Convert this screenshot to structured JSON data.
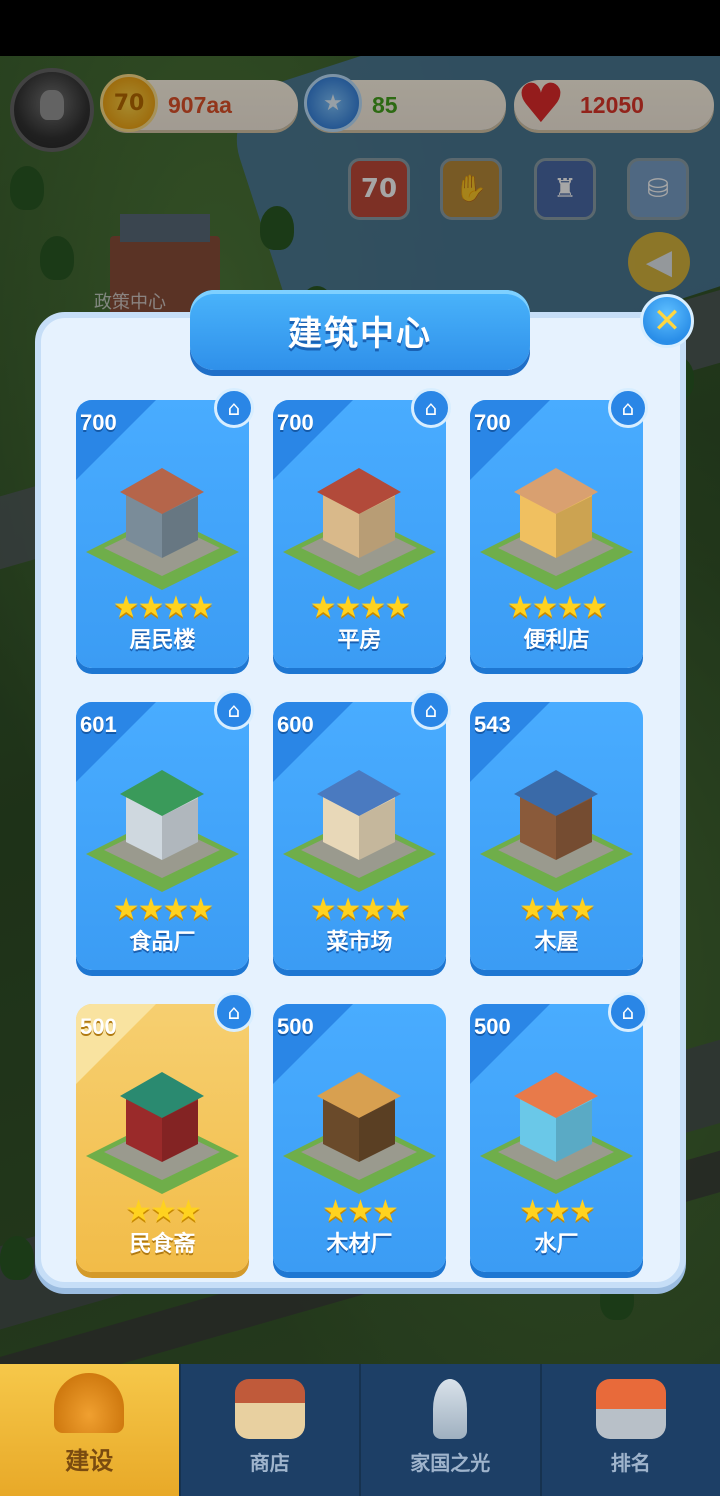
{
  "hud": {
    "coins": "907aa",
    "stars": "85",
    "hearts": "12050",
    "coin_icon_text": "70",
    "quick_buttons": [
      {
        "icon": "70-anniversary-icon",
        "text": "70"
      },
      {
        "icon": "handshake-icon",
        "text": ""
      },
      {
        "icon": "firefighter-icon",
        "text": ""
      },
      {
        "icon": "water-tower-icon",
        "text": ""
      }
    ]
  },
  "map": {
    "label": "政策中心"
  },
  "dialog": {
    "title": "建筑中心",
    "cards": [
      {
        "count": "700",
        "name": "居民楼",
        "stars": "★★★★",
        "style": "blue",
        "home": true,
        "art": "apartment"
      },
      {
        "count": "700",
        "name": "平房",
        "stars": "★★★★",
        "style": "blue",
        "home": true,
        "art": "bungalow"
      },
      {
        "count": "700",
        "name": "便利店",
        "stars": "★★★★",
        "style": "blue",
        "home": true,
        "art": "store"
      },
      {
        "count": "601",
        "name": "食品厂",
        "stars": "★★★★",
        "style": "blue",
        "home": true,
        "art": "factory"
      },
      {
        "count": "600",
        "name": "菜市场",
        "stars": "★★★★",
        "style": "blue",
        "home": true,
        "art": "market"
      },
      {
        "count": "543",
        "name": "木屋",
        "stars": "★★★",
        "style": "blue",
        "home": false,
        "art": "cabin"
      },
      {
        "count": "500",
        "name": "民食斋",
        "stars": "★★★",
        "style": "gold",
        "home": true,
        "art": "temple"
      },
      {
        "count": "500",
        "name": "木材厂",
        "stars": "★★★",
        "style": "blue",
        "home": false,
        "art": "lumber"
      },
      {
        "count": "500",
        "name": "水厂",
        "stars": "★★★",
        "style": "blue",
        "home": true,
        "art": "waterplant"
      }
    ]
  },
  "nav": [
    {
      "label": "建设",
      "icon": "hard-hat-icon",
      "active": true
    },
    {
      "label": "商店",
      "icon": "shop-icon",
      "active": false
    },
    {
      "label": "家国之光",
      "icon": "rocket-icon",
      "active": false
    },
    {
      "label": "排名",
      "icon": "ranking-icon",
      "active": false
    }
  ]
}
